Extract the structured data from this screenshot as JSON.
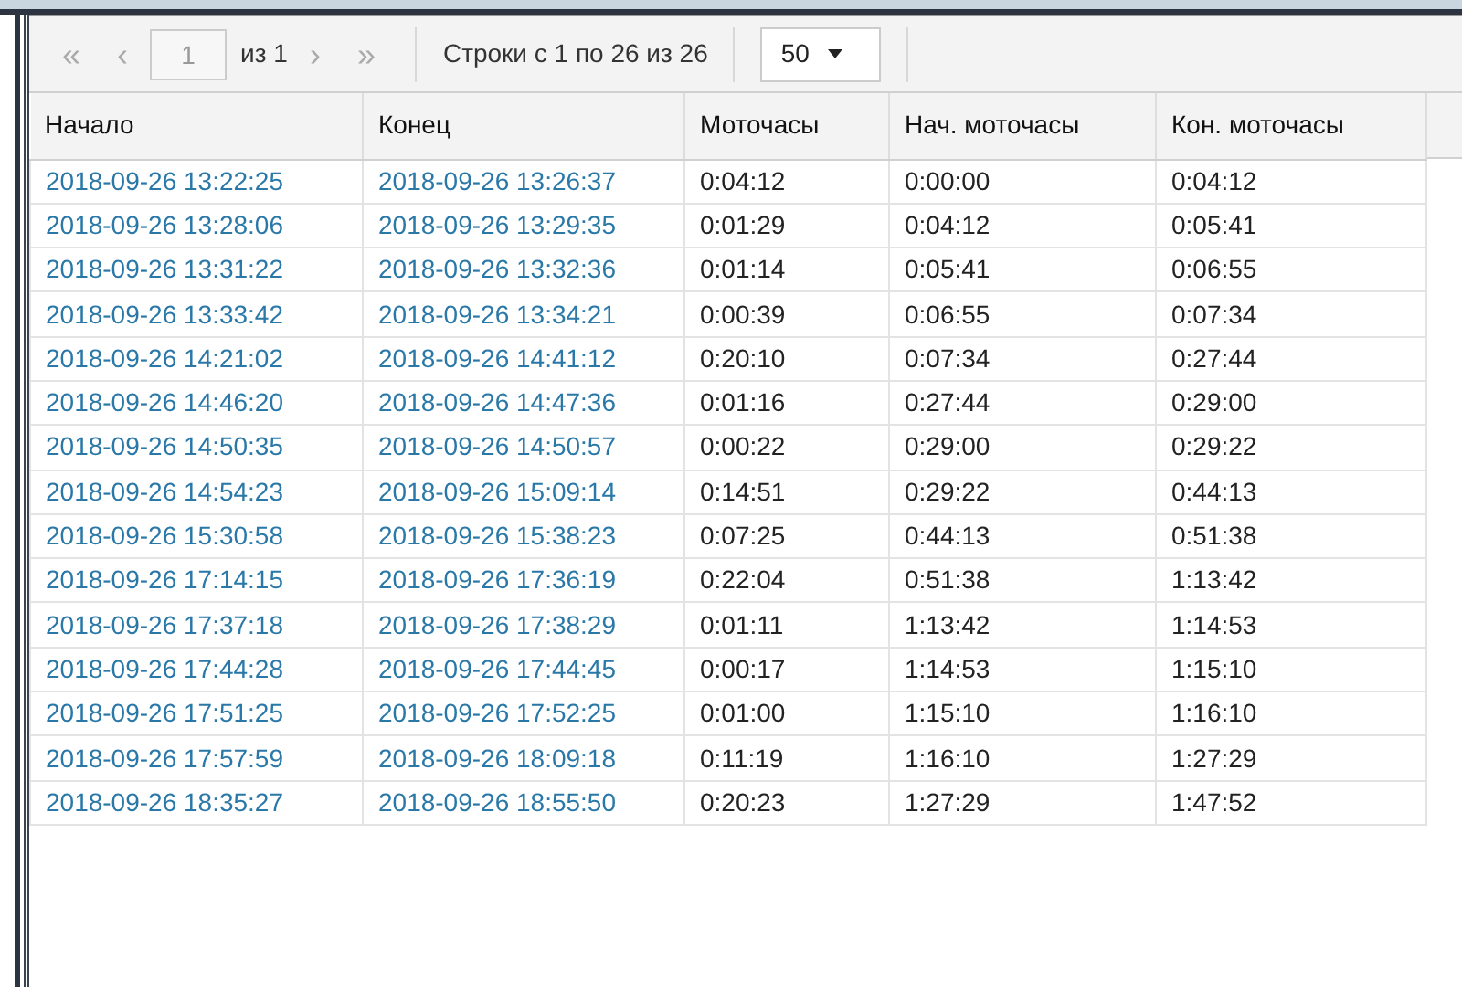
{
  "pager": {
    "first": {
      "label": "«",
      "disabled": true
    },
    "prev": {
      "label": "‹",
      "disabled": true
    },
    "page": "1",
    "page_of": "из 1",
    "next": {
      "label": "›",
      "disabled": true
    },
    "last": {
      "label": "»",
      "disabled": true
    },
    "rows_info": "Строки с 1 по 26 из 26",
    "page_size": "50"
  },
  "table": {
    "columns": [
      "Начало",
      "Конец",
      "Моточасы",
      "Нач. моточасы",
      "Кон. моточасы"
    ],
    "rows": [
      [
        "2018-09-26 13:22:25",
        "2018-09-26 13:26:37",
        "0:04:12",
        "0:00:00",
        "0:04:12"
      ],
      [
        "2018-09-26 13:28:06",
        "2018-09-26 13:29:35",
        "0:01:29",
        "0:04:12",
        "0:05:41"
      ],
      [
        "2018-09-26 13:31:22",
        "2018-09-26 13:32:36",
        "0:01:14",
        "0:05:41",
        "0:06:55"
      ],
      [
        "2018-09-26 13:33:42",
        "2018-09-26 13:34:21",
        "0:00:39",
        "0:06:55",
        "0:07:34"
      ],
      [
        "2018-09-26 14:21:02",
        "2018-09-26 14:41:12",
        "0:20:10",
        "0:07:34",
        "0:27:44"
      ],
      [
        "2018-09-26 14:46:20",
        "2018-09-26 14:47:36",
        "0:01:16",
        "0:27:44",
        "0:29:00"
      ],
      [
        "2018-09-26 14:50:35",
        "2018-09-26 14:50:57",
        "0:00:22",
        "0:29:00",
        "0:29:22"
      ],
      [
        "2018-09-26 14:54:23",
        "2018-09-26 15:09:14",
        "0:14:51",
        "0:29:22",
        "0:44:13"
      ],
      [
        "2018-09-26 15:30:58",
        "2018-09-26 15:38:23",
        "0:07:25",
        "0:44:13",
        "0:51:38"
      ],
      [
        "2018-09-26 17:14:15",
        "2018-09-26 17:36:19",
        "0:22:04",
        "0:51:38",
        "1:13:42"
      ],
      [
        "2018-09-26 17:37:18",
        "2018-09-26 17:38:29",
        "0:01:11",
        "1:13:42",
        "1:14:53"
      ],
      [
        "2018-09-26 17:44:28",
        "2018-09-26 17:44:45",
        "0:00:17",
        "1:14:53",
        "1:15:10"
      ],
      [
        "2018-09-26 17:51:25",
        "2018-09-26 17:52:25",
        "0:01:00",
        "1:15:10",
        "1:16:10"
      ],
      [
        "2018-09-26 17:57:59",
        "2018-09-26 18:09:18",
        "0:11:19",
        "1:16:10",
        "1:27:29"
      ],
      [
        "2018-09-26 18:35:27",
        "2018-09-26 18:55:50",
        "0:20:23",
        "1:27:29",
        "1:47:52"
      ]
    ]
  }
}
